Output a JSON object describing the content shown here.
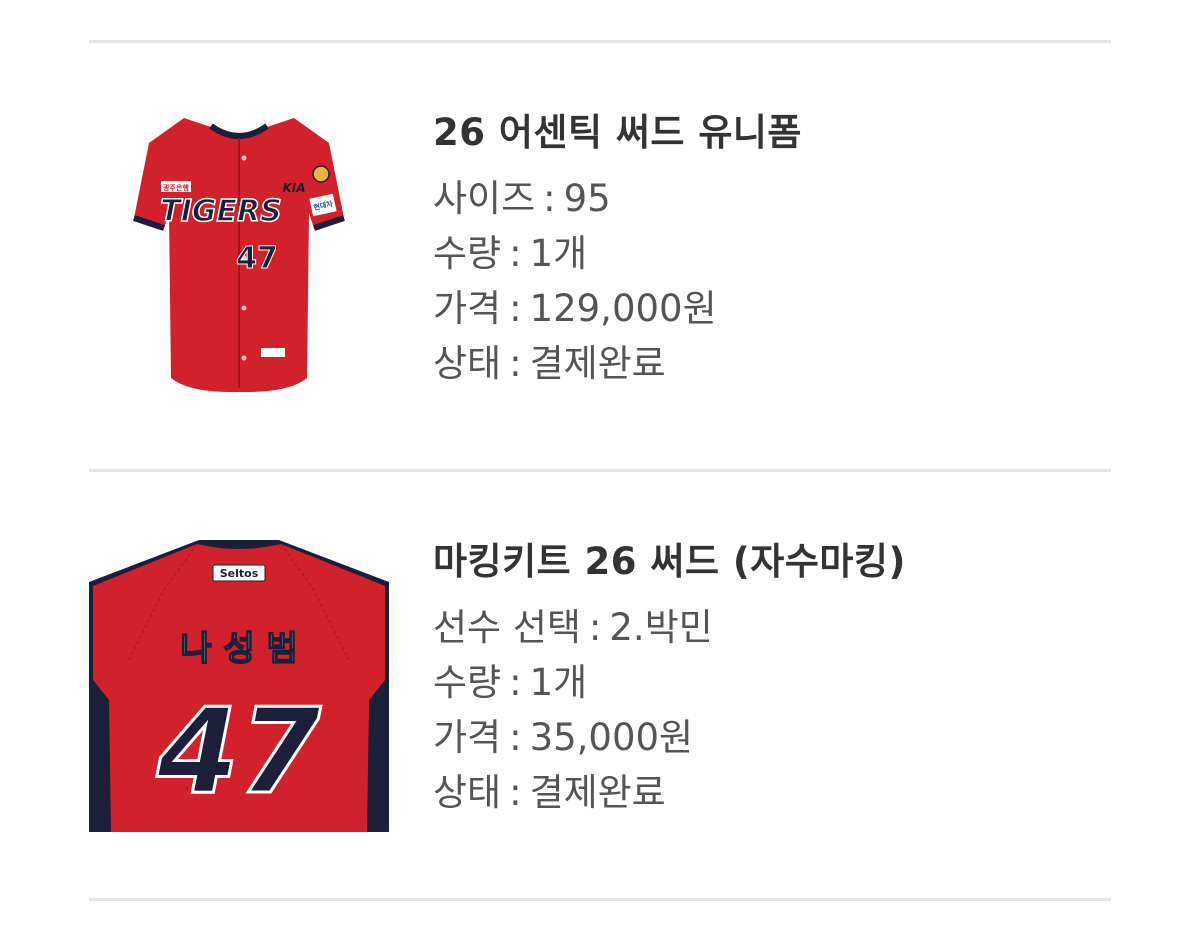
{
  "items": [
    {
      "title": "26 어센틱 써드 유니폼",
      "thumbnail": {
        "kind": "jersey-front",
        "brand_text": "TIGERS",
        "number": "47",
        "sponsor_left": "광주은행",
        "sponsor_right": "현대차",
        "logo": "KIA",
        "color_primary": "#d1222b",
        "color_trim": "#1c1f3a"
      },
      "details": [
        {
          "label": "사이즈",
          "value": "95"
        },
        {
          "label": "수량",
          "value": "1개"
        },
        {
          "label": "가격",
          "value": "129,000원"
        },
        {
          "label": "상태",
          "value": "결제완료"
        }
      ]
    },
    {
      "title": "마킹키트 26 써드 (자수마킹)",
      "thumbnail": {
        "kind": "jersey-back",
        "sponsor": "Seltos",
        "player_name": "나 성 범",
        "number": "47",
        "color_primary": "#d1222b",
        "color_trim": "#1c1f3a"
      },
      "details": [
        {
          "label": "선수 선택",
          "value": "2.박민"
        },
        {
          "label": "수량",
          "value": "1개"
        },
        {
          "label": "가격",
          "value": "35,000원"
        },
        {
          "label": "상태",
          "value": "결제완료"
        }
      ]
    }
  ],
  "separator": ":"
}
